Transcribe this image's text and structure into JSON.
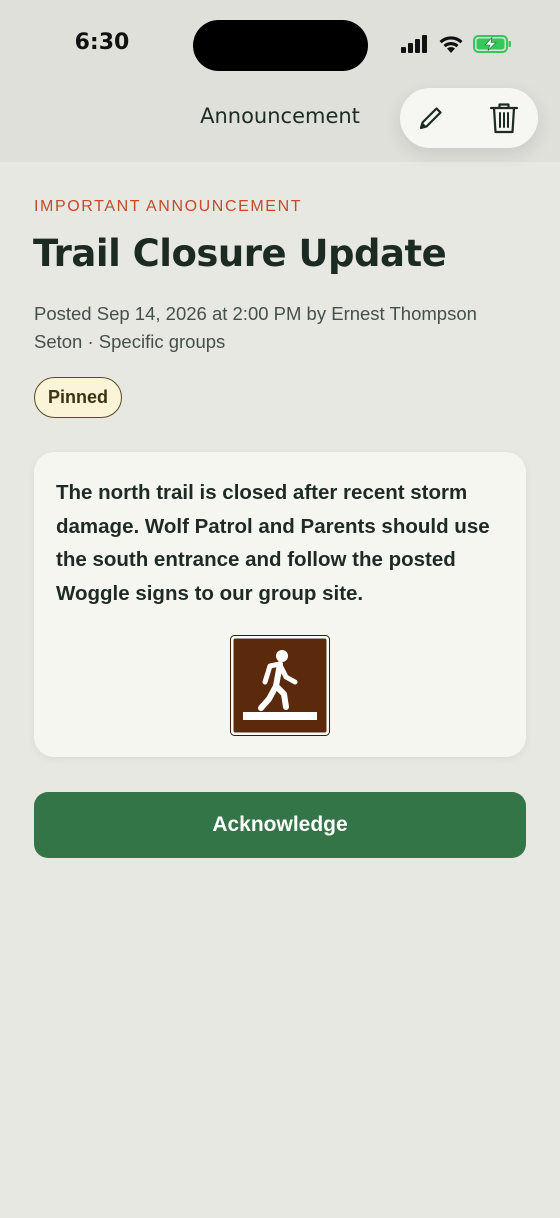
{
  "status_bar": {
    "time": "6:30"
  },
  "nav": {
    "title": "Announcement",
    "actions": [
      {
        "icon": "pencil-icon",
        "label": "Edit"
      },
      {
        "icon": "trash-icon",
        "label": "Delete"
      }
    ]
  },
  "announcement": {
    "eyebrow": "IMPORTANT ANNOUNCEMENT",
    "title": "Trail Closure Update",
    "meta": "Posted Sep 14, 2026 at 2:00 PM by Ernest Thompson Seton · Specific groups",
    "badge": "Pinned",
    "body": "The north trail is closed after recent storm damage. Wolf Patrol and Parents should use the south entrance and follow the posted Woggle signs to our group site.",
    "image_icon": "hiking-trail-sign-icon"
  },
  "actions": {
    "acknowledge_label": "Acknowledge"
  },
  "colors": {
    "accent_red": "#c64a28",
    "primary_green": "#347548",
    "sign_brown": "#5b2a0d",
    "background": "#e7e8e2"
  }
}
